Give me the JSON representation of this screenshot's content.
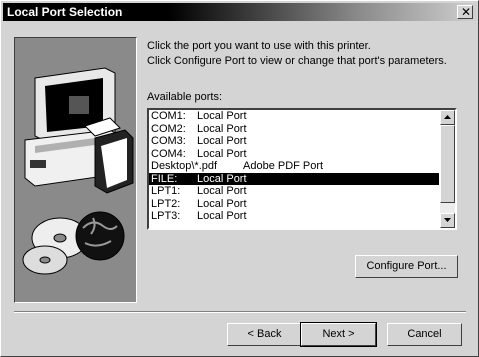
{
  "window": {
    "title": "Local Port Selection"
  },
  "instructions": {
    "line1": "Click the port you want to use with this printer.",
    "line2": "Click Configure Port to view or change that port's parameters."
  },
  "ports": {
    "label": "Available ports:",
    "items": [
      {
        "port": "COM1:",
        "desc": "Local Port"
      },
      {
        "port": "COM2:",
        "desc": "Local Port"
      },
      {
        "port": "COM3:",
        "desc": "Local Port"
      },
      {
        "port": "COM4:",
        "desc": "Local Port"
      },
      {
        "port": "Desktop\\*.pdf",
        "desc": "Adobe PDF Port"
      },
      {
        "port": "FILE:",
        "desc": "Local Port"
      },
      {
        "port": "LPT1:",
        "desc": "Local Port"
      },
      {
        "port": "LPT2:",
        "desc": "Local Port"
      },
      {
        "port": "LPT3:",
        "desc": "Local Port"
      }
    ],
    "selected": "FILE:"
  },
  "buttons": {
    "configure": "Configure Port...",
    "back": "< Back",
    "next": "Next >",
    "cancel": "Cancel"
  },
  "icons": {
    "close": "close-icon",
    "scroll_up": "arrow-up-icon",
    "scroll_down": "arrow-down-icon",
    "illustration": "printer-wizard-illustration"
  }
}
